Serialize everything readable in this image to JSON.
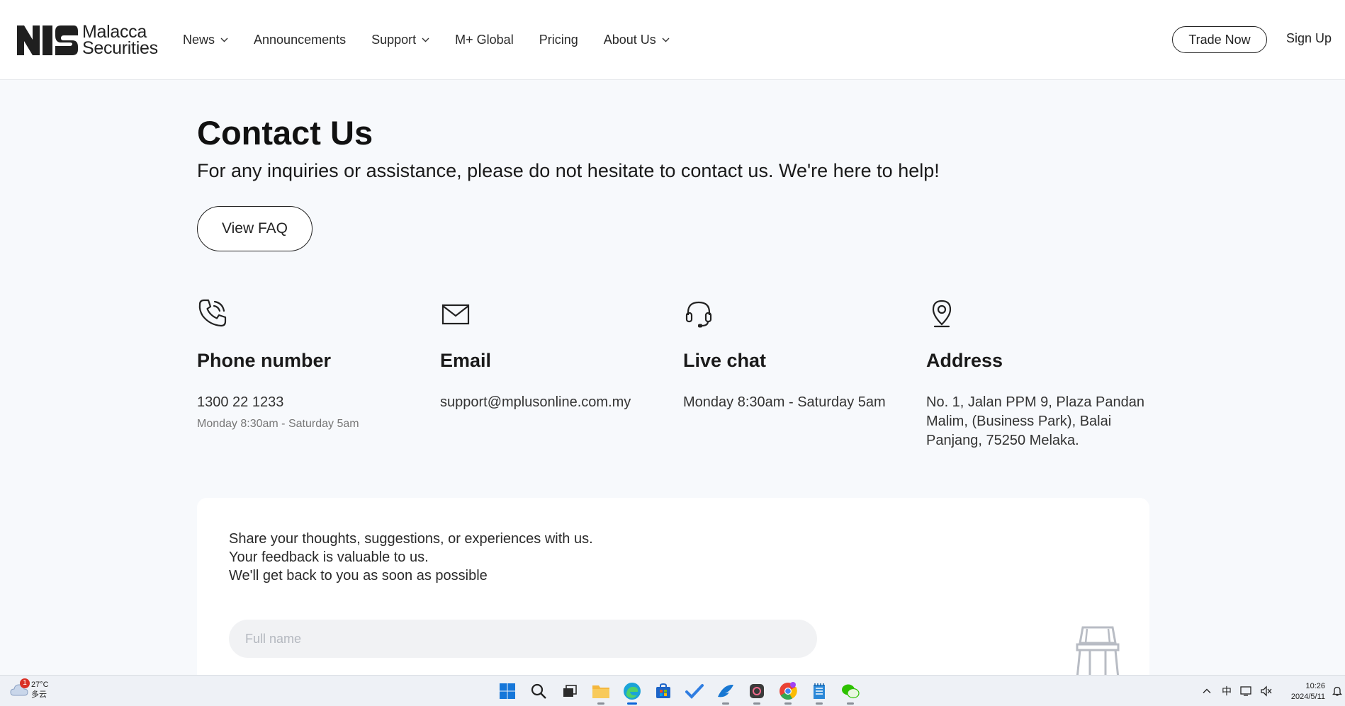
{
  "header": {
    "logo_line1": "Malacca",
    "logo_line2": "Securities",
    "nav": [
      {
        "label": "News",
        "has_dropdown": true
      },
      {
        "label": "Announcements",
        "has_dropdown": false
      },
      {
        "label": "Support",
        "has_dropdown": true
      },
      {
        "label": "M+ Global",
        "has_dropdown": false
      },
      {
        "label": "Pricing",
        "has_dropdown": false
      },
      {
        "label": "About Us",
        "has_dropdown": true
      }
    ],
    "trade_now": "Trade Now",
    "sign_up": "Sign Up"
  },
  "main": {
    "title": "Contact Us",
    "subtitle": "For any inquiries or assistance, please do not hesitate to contact us. We're here to help!",
    "faq_button": "View FAQ",
    "contacts": {
      "phone": {
        "icon": "phone-icon",
        "heading": "Phone number",
        "value": "1300 22 1233",
        "note": "Monday 8:30am - Saturday 5am"
      },
      "email": {
        "icon": "mail-icon",
        "heading": "Email",
        "value": "support@mplusonline.com.my"
      },
      "chat": {
        "icon": "headset-icon",
        "heading": "Live chat",
        "value": "Monday 8:30am - Saturday 5am"
      },
      "address": {
        "icon": "location-pin-icon",
        "heading": "Address",
        "value": "No. 1, Jalan PPM 9, Plaza Pandan Malim, (Business Park), Balai Panjang, 75250 Melaka."
      }
    }
  },
  "feedback": {
    "line1": "Share your thoughts, suggestions, or experiences with us.",
    "line2": "Your feedback is valuable to us.",
    "line3": "We'll get back to you as soon as possible",
    "full_name_placeholder": "Full name"
  },
  "taskbar": {
    "weather_badge": "1",
    "temperature": "27°C",
    "condition": "多云",
    "ime": "中",
    "time": "10:26",
    "date": "2024/5/11"
  },
  "colors": {
    "accent_blue": "#0a64d8",
    "page_bg": "#f7f9fc"
  }
}
